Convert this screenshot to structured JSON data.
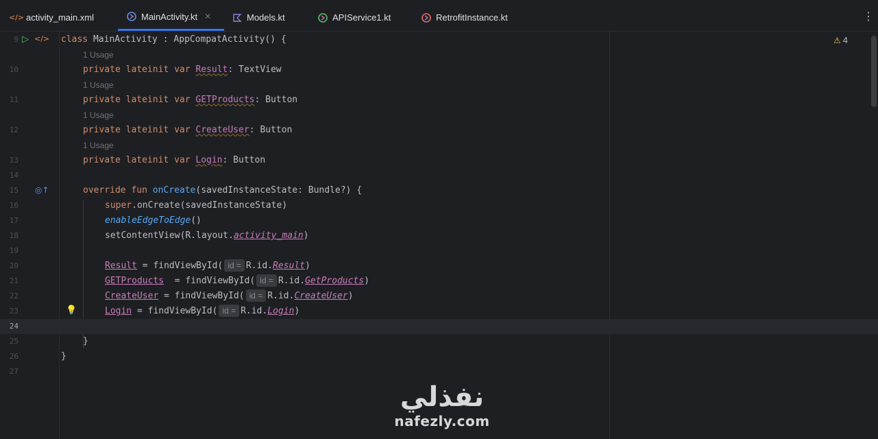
{
  "tabs": [
    {
      "label": "activity_main.xml",
      "icon": "xml-file-icon",
      "active": false
    },
    {
      "label": "MainActivity.kt",
      "icon": "kotlin-class-icon",
      "active": true
    },
    {
      "label": "Models.kt",
      "icon": "kotlin-file-icon",
      "active": false
    },
    {
      "label": "APIService1.kt",
      "icon": "kotlin-interface-icon",
      "active": false
    },
    {
      "label": "RetrofitInstance.kt",
      "icon": "kotlin-object-icon",
      "active": false
    }
  ],
  "warnings": {
    "count": "4"
  },
  "usage_label": "1 Usage",
  "hint_label": "id =",
  "lines": {
    "l9": "9",
    "l10": "10",
    "l11": "11",
    "l12": "12",
    "l13": "13",
    "l14": "14",
    "l15": "15",
    "l16": "16",
    "l17": "17",
    "l18": "18",
    "l19": "19",
    "l20": "20",
    "l21": "21",
    "l22": "22",
    "l23": "23",
    "l24": "24",
    "l25": "25",
    "l26": "26",
    "l27": "27"
  },
  "code": {
    "class_kw": "class",
    "class_name": " MainActivity : AppCompatActivity() {",
    "private": "private",
    "lateinit": "lateinit",
    "var": "var",
    "v_result": "Result",
    "t_textview": ": TextView",
    "v_getproducts": "GETProducts",
    "t_button": ": Button",
    "v_createuser": "CreateUser",
    "v_login": "Login",
    "override": "override",
    "fun": "fun",
    "oncreate": "onCreate",
    "oncreate_params": "(savedInstanceState: Bundle?) {",
    "super_kw": "super",
    "super_call": ".onCreate(savedInstanceState)",
    "edge": "enableEdgeToEdge",
    "edge_paren": "()",
    "setcontent": "setContentView(R.layout.",
    "activity_main": "activity_main",
    "close_paren": ")",
    "find_eq": " = findViewById(",
    "find_eq2": "  = findViewById(",
    "rid": "R.id.",
    "r_result": "Result",
    "r_getproducts": "GetProducts",
    "r_createuser": "CreateUser",
    "r_login": "Login",
    "close_brace_inner": "}",
    "close_brace_outer": "}"
  },
  "watermark": {
    "arabic": "نفذلي",
    "latin": "nafezly.com"
  }
}
